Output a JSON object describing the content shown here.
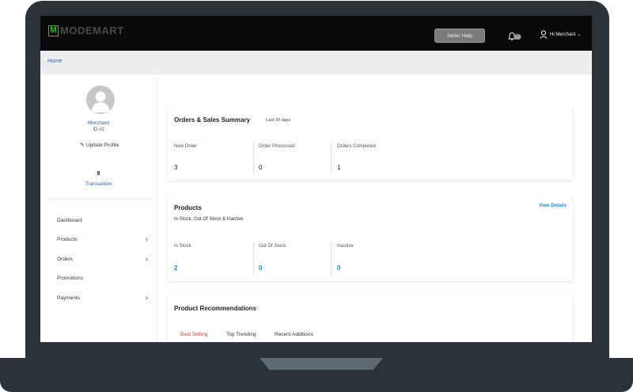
{
  "header": {
    "logo_letter": "M",
    "logo_text": "MODEMART",
    "seller_help": "Seller Help",
    "notification_count": "0",
    "user_greeting": "Hi Merchant"
  },
  "breadcrumb": {
    "home": "Home"
  },
  "profile": {
    "name": "Merchant",
    "id": "ID #2",
    "update_label": "Update Profile",
    "transaction_count": "8",
    "transaction_label": "Transaction"
  },
  "nav": [
    {
      "label": "Dashboard",
      "chevron": false
    },
    {
      "label": "Products",
      "chevron": true
    },
    {
      "label": "Orders",
      "chevron": true
    },
    {
      "label": "Promotions",
      "chevron": false
    },
    {
      "label": "Payments",
      "chevron": true
    }
  ],
  "orders_summary": {
    "title": "Orders & Sales Summary",
    "period": "Last 30 days",
    "stats": [
      {
        "label": "New Order",
        "value": "3"
      },
      {
        "label": "Order Processed",
        "value": "0"
      },
      {
        "label": "Orders Completed",
        "value": "1"
      }
    ]
  },
  "products": {
    "title": "Products",
    "subtitle": "In Stock, Out Of Stock & Inactive",
    "view_details": "View Details",
    "stats": [
      {
        "label": "In Stock",
        "value": "2"
      },
      {
        "label": "Out Of Stock",
        "value": "0"
      },
      {
        "label": "Inactive",
        "value": "0"
      }
    ]
  },
  "recommendations": {
    "title": "Product Recommendations",
    "tabs": [
      "Best Selling",
      "Top Trending",
      "Recent Additions"
    ]
  },
  "colors": {
    "topbar": "#0a0a0a",
    "logo_green": "#3bb54a",
    "link_blue": "#2b66b5",
    "stat_blue": "#1e88e5",
    "active_tab_red": "#d9342b",
    "frame": "#2c3338"
  }
}
